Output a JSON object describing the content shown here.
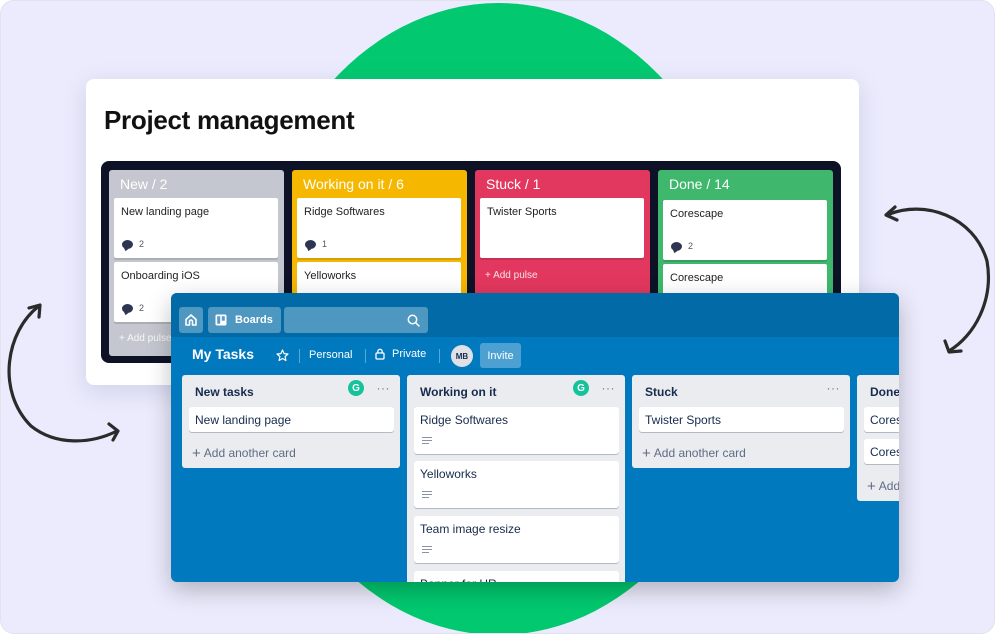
{
  "pm_board": {
    "title": "Project management",
    "columns": [
      {
        "title": "New / 2",
        "color": "#c4c7cf",
        "cards": [
          {
            "title": "New landing page",
            "comments": "2"
          },
          {
            "title": "Onboarding iOS",
            "comments": "2"
          }
        ],
        "add_label": "+ Add pulse"
      },
      {
        "title": "Working on it / 6",
        "color": "#f5b700",
        "cards": [
          {
            "title": "Ridge Softwares",
            "comments": "1"
          },
          {
            "title": "Yelloworks",
            "comments": ""
          }
        ],
        "add_label": ""
      },
      {
        "title": "Stuck / 1",
        "color": "#e2375e",
        "cards": [
          {
            "title": "Twister Sports",
            "comments": ""
          }
        ],
        "add_label": "+ Add pulse"
      },
      {
        "title": "Done / 14",
        "color": "#3fb76c",
        "cards": [
          {
            "title": "Corescape",
            "comments": "2"
          },
          {
            "title": "Corescape",
            "comments": ""
          }
        ],
        "add_label": ""
      }
    ]
  },
  "trello": {
    "topbar": {
      "home_icon": "home-icon",
      "boards_label": "Boards",
      "search_placeholder": "",
      "search_icon": "search-icon"
    },
    "boardbar": {
      "title": "My Tasks",
      "star_icon": "star-icon",
      "team_label": "Personal",
      "visibility_label": "Private",
      "lock_icon": "lock-icon",
      "avatar_initials": "MB",
      "invite_label": "Invite"
    },
    "lists": [
      {
        "title": "New tasks",
        "cards": [
          {
            "title": "New landing page",
            "has_description": false
          }
        ],
        "add_label": "Add another card"
      },
      {
        "title": "Working on it",
        "cards": [
          {
            "title": "Ridge Softwares",
            "has_description": true
          },
          {
            "title": "Yelloworks",
            "has_description": true
          },
          {
            "title": "Team image resize",
            "has_description": true
          },
          {
            "title": "Banner for HR",
            "has_description": false
          }
        ],
        "add_label": ""
      },
      {
        "title": "Stuck",
        "cards": [
          {
            "title": "Twister Sports",
            "has_description": false
          }
        ],
        "add_label": "Add another card"
      },
      {
        "title": "Done",
        "cards": [
          {
            "title": "Corescape",
            "has_description": false
          },
          {
            "title": "Corescape",
            "has_description": false
          }
        ],
        "add_label": "Add another card"
      }
    ],
    "menu_glyph": "···",
    "grammarly_glyph": "G"
  },
  "colors": {
    "background": "#ebebfd",
    "green_accent": "#02c96f",
    "trello_blue": "#0079bf",
    "trello_topbar": "#026aa7"
  }
}
